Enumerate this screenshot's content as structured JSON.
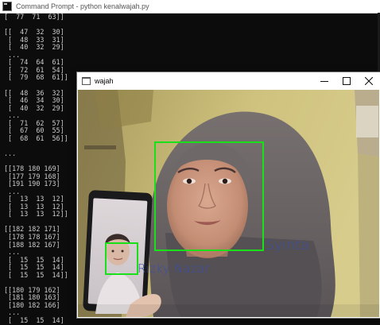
{
  "cmd_window": {
    "title": "Command Prompt - python  kenalwajah.py",
    "lines": [
      "[  77  71  63]]",
      "",
      "[[  47  32  30]",
      " [  48  33  31]",
      " [  40  32  29]",
      " ...",
      " [  74  64  61]",
      " [  72  61  54]",
      " [  79  68  61]]",
      "",
      "[[  48  36  32]",
      " [  46  34  30]",
      " [  40  32  29]",
      " ...",
      " [  71  62  57]",
      " [  67  60  55]",
      " [  68  61  56]]",
      "",
      "...",
      "",
      "[[178 180 169]",
      " [177 179 168]",
      " [191 190 173]",
      " ...",
      " [  13  13  12]",
      " [  13  13  12]",
      " [  13  13  12]]",
      "",
      "[[182 182 171]",
      " [178 178 167]",
      " [188 182 167]",
      " ...",
      " [  15  15  14]",
      " [  15  15  14]",
      " [  15  15  14]]",
      "",
      "[[180 179 162]",
      " [181 180 163]",
      " [180 182 166]",
      " ...",
      " [  15  15  14]"
    ]
  },
  "image_window": {
    "title": "wajah",
    "controls": {
      "minimize_icon": "minimize-icon",
      "maximize_icon": "maximize-icon",
      "close_icon": "close-icon"
    }
  },
  "detections": [
    {
      "label": "Syinta"
    },
    {
      "label": "Rizky Nazar"
    }
  ],
  "colors": {
    "console_bg": "#0c0c0c",
    "console_text": "#cccccc",
    "box": "#19e019",
    "label": "#3b4ea8"
  }
}
